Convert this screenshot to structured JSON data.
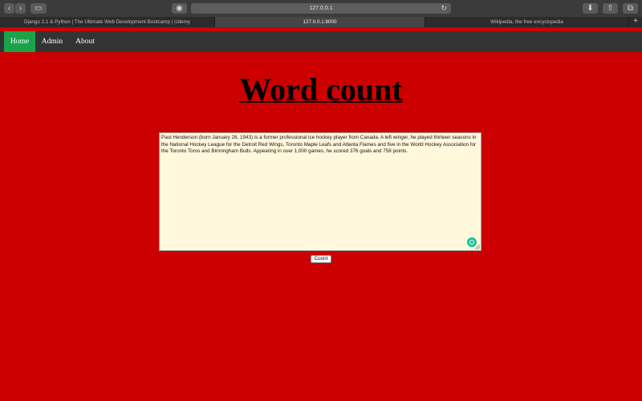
{
  "browser": {
    "url": "127.0.0.1",
    "tabs": [
      {
        "label": "Django 2.1 & Python | The Ultimate Web Development Bootcamp | Udemy"
      },
      {
        "label": "127.0.0.1:8000"
      },
      {
        "label": "Wikipedia, the free encyclopedia"
      }
    ],
    "new_tab_symbol": "+",
    "toolbar_icons": [
      "back-icon",
      "forward-icon",
      "sidebar-icon",
      "privacy-icon",
      "reload-icon",
      "download-icon",
      "share-icon",
      "tabs-icon"
    ]
  },
  "nav": {
    "items": [
      {
        "label": "Home"
      },
      {
        "label": "Admin"
      },
      {
        "label": "About"
      }
    ],
    "active_color": "#1aa34a",
    "bar_color": "#333333"
  },
  "page": {
    "background": "#cc0000",
    "title": "Word count",
    "textarea_value": "Paul Henderson (born January 28, 1943) is a former professional ice hockey player from Canada. A left winger, he played thirteen seasons in the National Hockey League for the Detroit Red Wings, Toronto Maple Leafs and Atlanta Flames and five in the World Hockey Association for the Toronto Toros and Birmingham Bulls. Appearing in over 1,000 games, he scored 376 goals and 758 points.",
    "count_button": "Count"
  }
}
